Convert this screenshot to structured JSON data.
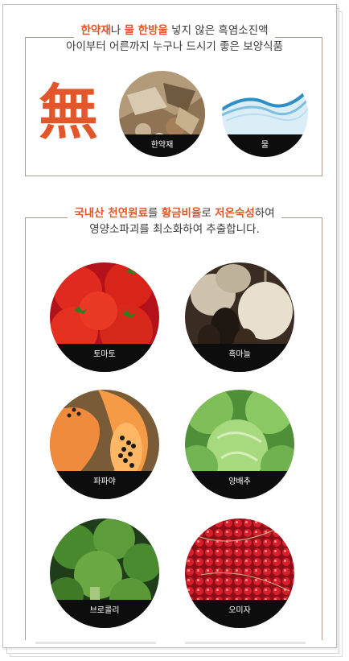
{
  "intro": {
    "line1": [
      {
        "text": "한약재",
        "hl": true
      },
      {
        "text": "나 ",
        "hl": false
      },
      {
        "text": "물 한방울",
        "hl": true
      },
      {
        "text": " 넣지 않은 흑염소진액",
        "hl": false
      }
    ],
    "line2": "아이부터 어른까지 누구나 드시기 좋은 보양식품",
    "symbol": "無",
    "items": [
      {
        "label": "한약재",
        "icon": "herbs-photo"
      },
      {
        "label": "물",
        "icon": "water-photo"
      }
    ]
  },
  "ingredients": {
    "line1": [
      {
        "text": "국내산 천연원료",
        "hl": true
      },
      {
        "text": "를 ",
        "hl": false
      },
      {
        "text": "황금비율",
        "hl": true
      },
      {
        "text": "로 ",
        "hl": false
      },
      {
        "text": "저온숙성",
        "hl": true
      },
      {
        "text": "하여",
        "hl": false
      }
    ],
    "line2": "영양소파괴를 최소화하여 추출합니다.",
    "items": [
      {
        "label": "토마토",
        "icon": "tomato-photo"
      },
      {
        "label": "흑마늘",
        "icon": "black-garlic-photo"
      },
      {
        "label": "파파야",
        "icon": "papaya-photo"
      },
      {
        "label": "양배추",
        "icon": "cabbage-photo"
      },
      {
        "label": "브로콜리",
        "icon": "broccoli-photo"
      },
      {
        "label": "오미자",
        "icon": "omija-photo"
      }
    ]
  },
  "colors": {
    "accent": "#e0582a",
    "border": "#a89b8c",
    "caption_bg": "#0d0d0d"
  }
}
